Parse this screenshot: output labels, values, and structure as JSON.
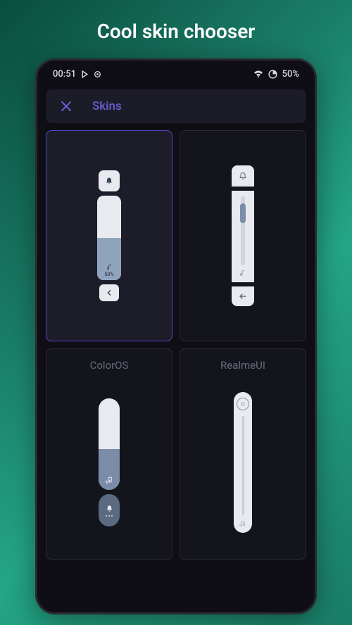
{
  "promo_title": "Cool skin chooser",
  "status": {
    "time": "00:51",
    "battery_text": "50%"
  },
  "header": {
    "title": "Skins"
  },
  "skins": [
    {
      "name": "",
      "selected": true,
      "volume_pct": "50%"
    },
    {
      "name": "",
      "selected": false
    },
    {
      "name": "ColorOS",
      "selected": false
    },
    {
      "name": "RealmeUI",
      "selected": false
    }
  ],
  "colors": {
    "accent": "#6b5dd3",
    "card_bg": "#14141c",
    "card_border": "#2a2a38",
    "selected_border": "#5548c8",
    "slider_light": "#e8eaf0",
    "slider_fill": "#8fa3bd"
  }
}
